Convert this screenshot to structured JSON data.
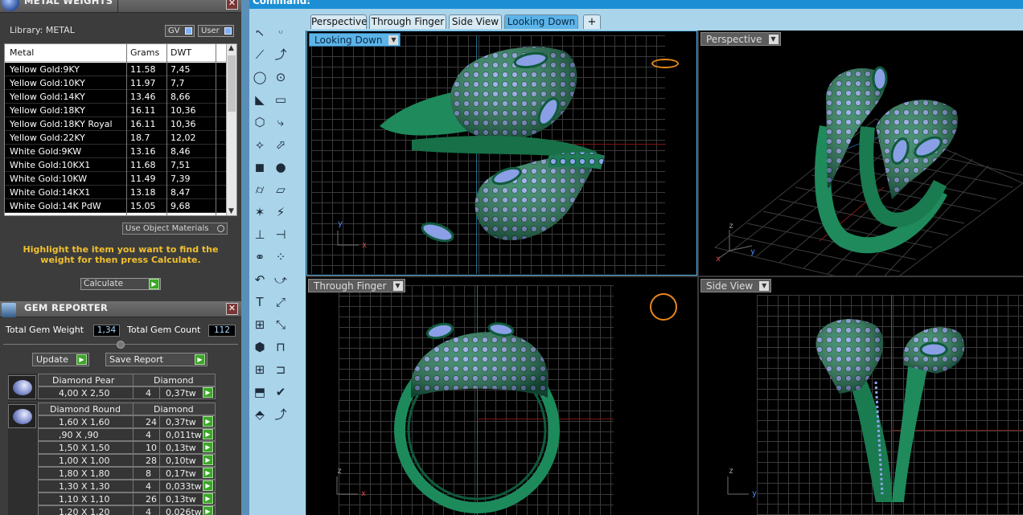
{
  "metal": {
    "title": "METAL WEIGHTS",
    "library_label": "Library: METAL",
    "gv_label": "GV",
    "user_label": "User",
    "headers": [
      "Metal",
      "Grams",
      "DWT"
    ],
    "rows": [
      [
        "Yellow Gold:9KY",
        "11.58",
        "7,45"
      ],
      [
        "Yellow Gold:10KY",
        "11.97",
        "7,7"
      ],
      [
        "Yellow Gold:14KY",
        "13.46",
        "8,66"
      ],
      [
        "Yellow Gold:18KY",
        "16.11",
        "10,36"
      ],
      [
        "Yellow Gold:18KY Royal",
        "16.11",
        "10,36"
      ],
      [
        "Yellow Gold:22KY",
        "18.7",
        "12,02"
      ],
      [
        "White Gold:9KW",
        "13.16",
        "8,46"
      ],
      [
        "White Gold:10KX1",
        "11.68",
        "7,51"
      ],
      [
        "White Gold:10KW",
        "11.49",
        "7,39"
      ],
      [
        "White Gold:14KX1",
        "13.18",
        "8,47"
      ],
      [
        "White Gold:14K PdW",
        "15.05",
        "9,68"
      ]
    ],
    "use_object_materials": "Use Object Materials",
    "hint": "Highlight the item you want to find the weight for then press Calculate.",
    "calculate_label": "Calculate"
  },
  "gem": {
    "title": "GEM REPORTER",
    "total_weight_label": "Total Gem Weight",
    "total_weight_value": "1,34",
    "total_count_label": "Total Gem Count",
    "total_count_value": "112",
    "update_label": "Update",
    "save_label": "Save Report",
    "pear": {
      "shape": "Diamond Pear",
      "material": "Diamond",
      "rows": [
        [
          "4,00 X 2,50",
          "4",
          "0,37tw"
        ]
      ]
    },
    "round": {
      "shape": "Diamond Round",
      "material": "Diamond",
      "rows": [
        [
          "1,60 X 1,60",
          "24",
          "0,37tw"
        ],
        [
          ",90 X ,90",
          "4",
          "0,011tw"
        ],
        [
          "1,50 X 1,50",
          "10",
          "0,13tw"
        ],
        [
          "1,00 X 1,00",
          "28",
          "0,10tw"
        ],
        [
          "1,80 X 1,80",
          "8",
          "0,17tw"
        ],
        [
          "1,30 X 1,30",
          "4",
          "0,033tw"
        ],
        [
          "1,10 X 1,10",
          "26",
          "0,13tw"
        ],
        [
          "1,20 X 1,20",
          "4",
          "0,026tw"
        ]
      ]
    }
  },
  "command": {
    "label": "Command:"
  },
  "tabs": [
    "Perspective",
    "Through Finger",
    "Side View",
    "Looking Down"
  ],
  "active_tab": "Looking Down",
  "tab_add": "+",
  "viewports": {
    "top_left": "Looking Down",
    "top_right": "Perspective",
    "bottom_left": "Through Finger",
    "bottom_right": "Side View"
  },
  "axes": {
    "x": "x",
    "y": "y",
    "z": "z"
  },
  "icons": [
    "select-arrow-icon",
    "point-icon",
    "polyline-icon",
    "curve-points-icon",
    "circle-icon",
    "ellipse-icon",
    "arc-icon",
    "rectangle-icon",
    "polygon-icon",
    "fillet-curve-icon",
    "cage-edit-icon",
    "extrude-icon",
    "box-icon",
    "sphere-icon",
    "cylinder-icon",
    "plane-icon",
    "gem-tool-icon",
    "highlight-icon",
    "split-icon",
    "trim-icon",
    "boolean-icon",
    "group-icon",
    "pipe-icon",
    "offset-icon",
    "text-icon",
    "scale-icon",
    "array-icon",
    "bend-icon",
    "solid-icon",
    "measure-icon",
    "grid-array-icon",
    "align-icon",
    "paint-icon",
    "check-icon",
    "material-icon",
    "flow-icon"
  ],
  "colors": {
    "accent": "#1c8fd4",
    "model_green": "#1f8a5c",
    "gem_blue": "#8fa6ee",
    "hint_yellow": "#f0c030"
  }
}
